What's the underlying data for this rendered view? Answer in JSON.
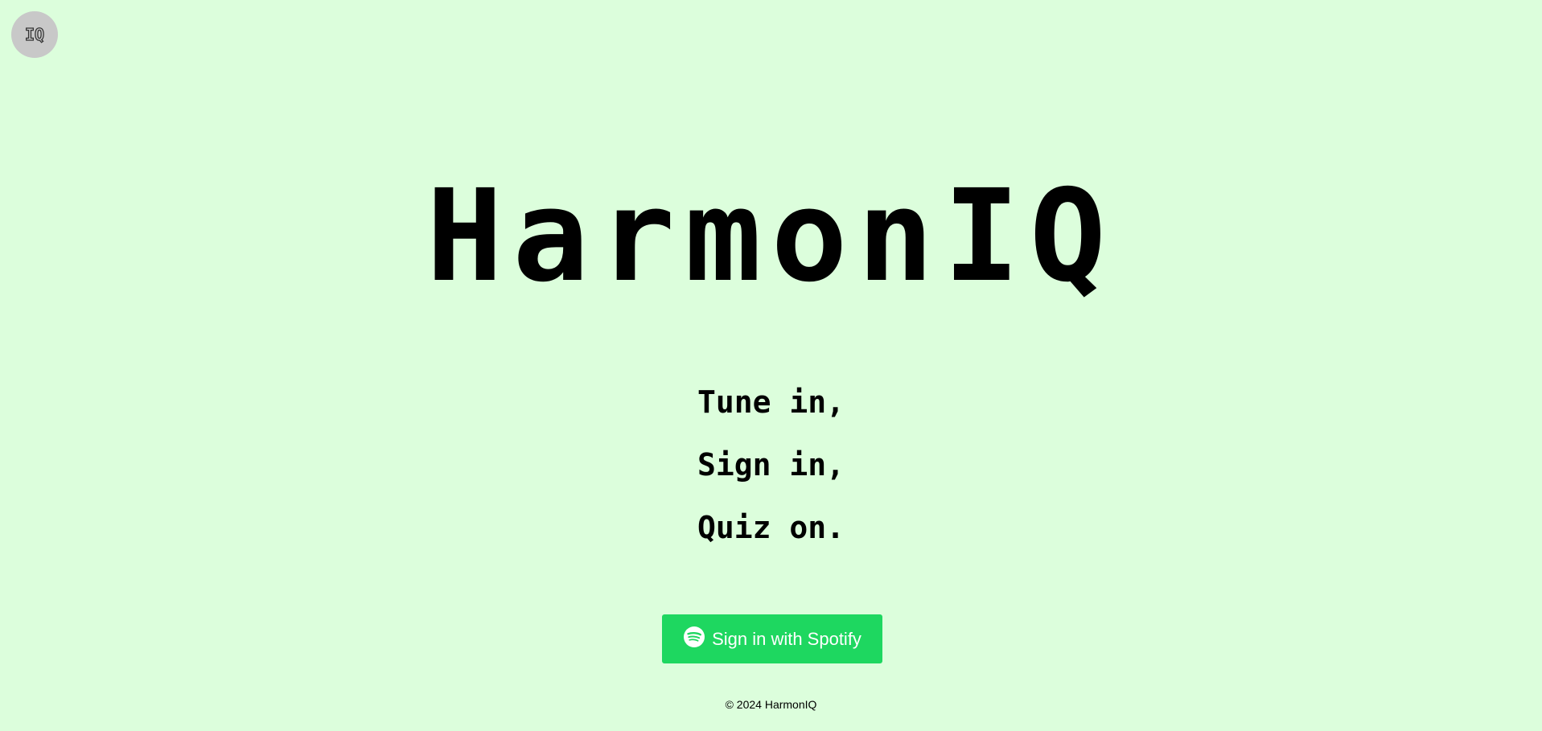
{
  "header": {
    "logo_text": "IQ"
  },
  "hero": {
    "title": "HarmonIQ",
    "taglines": [
      "Tune in,",
      "Sign in,",
      "Quiz on."
    ]
  },
  "auth": {
    "spotify_button_label": "Sign in with Spotify",
    "spotify_icon": "spotify-icon"
  },
  "footer": {
    "copyright": "© 2024 HarmonIQ"
  },
  "colors": {
    "background": "#dcfedc",
    "spotify_green": "#1ed760",
    "logo_badge": "#c8c8c8"
  }
}
